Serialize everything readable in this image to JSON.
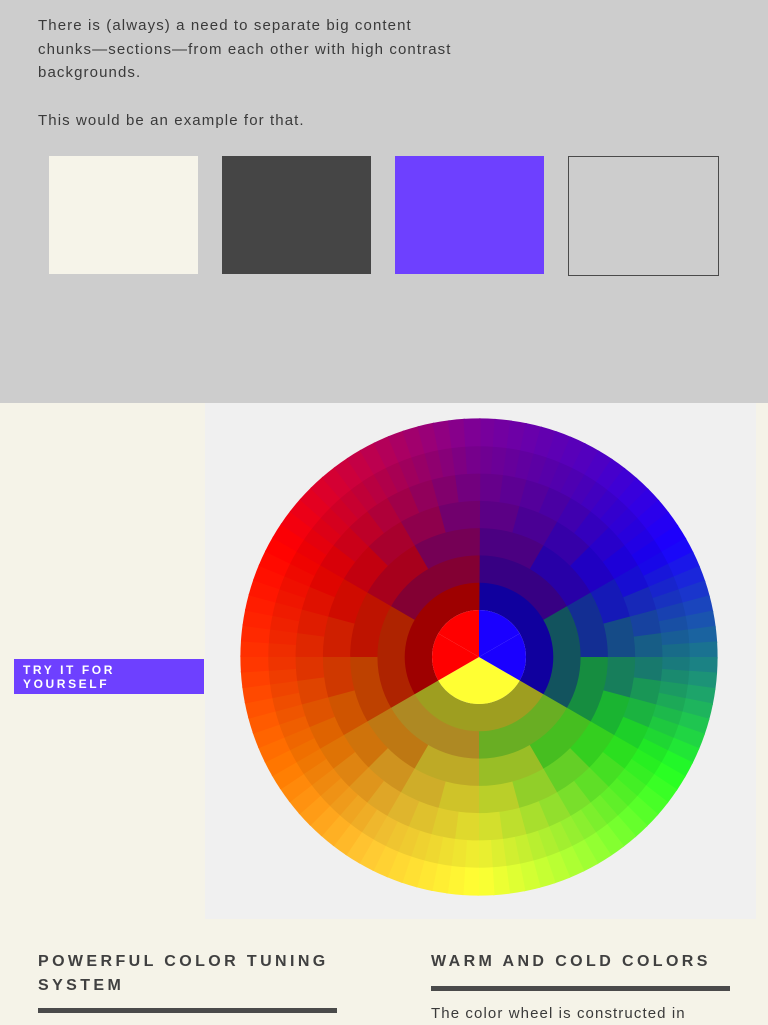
{
  "intro": {
    "paragraph1": "There is (always) a need to separate big content chunks—sections—from each other with high contrast backgrounds.",
    "paragraph2": "This would be an example for that."
  },
  "swatches": [
    {
      "name": "cream",
      "color": "#f6f4e9"
    },
    {
      "name": "dark-gray",
      "color": "#454545"
    },
    {
      "name": "purple",
      "color": "#6e40ff"
    },
    {
      "name": "outline",
      "color": "transparent"
    }
  ],
  "wheel": {
    "center_colors": [
      "#ff0000",
      "#1a00ff",
      "#ffff33"
    ]
  },
  "cta": {
    "label": "TRY IT FOR YOURSELF",
    "color": "#6e40ff"
  },
  "columns": [
    {
      "title": "POWERFUL COLOR TUNING SYSTEM",
      "text": ""
    },
    {
      "title": "WARM AND COLD COLORS",
      "text": "The color wheel is constructed in"
    }
  ]
}
